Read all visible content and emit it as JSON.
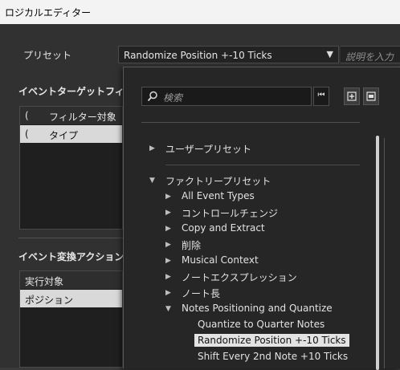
{
  "window": {
    "title": "ロジカルエディター"
  },
  "preset": {
    "label": "プリセット",
    "value": "Randomize Position +-10 Ticks",
    "description_placeholder": "説明を入力"
  },
  "target_filter": {
    "title": "イベントターゲットフィルタ",
    "headers": [
      "(",
      "フィルター対象"
    ],
    "rows": [
      {
        "paren": "(",
        "target": "タイプ"
      }
    ]
  },
  "actions": {
    "title": "イベント変換アクション",
    "headers": [
      "実行対象"
    ],
    "rows": [
      {
        "target": "ポジション"
      }
    ]
  },
  "popup": {
    "search_placeholder": "検索",
    "groups": [
      {
        "label": "ユーザープリセット",
        "expanded": false
      },
      {
        "label": "ファクトリープリセット",
        "expanded": true
      }
    ],
    "factory_items": [
      {
        "label": "All Event Types",
        "expanded": false
      },
      {
        "label": "コントロールチェンジ",
        "expanded": false
      },
      {
        "label": "Copy and Extract",
        "expanded": false
      },
      {
        "label": "削除",
        "expanded": false
      },
      {
        "label": "Musical Context",
        "expanded": false
      },
      {
        "label": "ノートエクスプレッション",
        "expanded": false
      },
      {
        "label": "ノート長",
        "expanded": false
      },
      {
        "label": "Notes Positioning and Quantize",
        "expanded": true
      }
    ],
    "sub_items": [
      {
        "label": "Quantize to Quarter Notes",
        "selected": false
      },
      {
        "label": "Randomize Position +-10 Ticks",
        "selected": true
      },
      {
        "label": "Shift Every 2nd Note +10 Ticks",
        "selected": false
      }
    ]
  },
  "colors": {
    "selection": "#e3e3e3",
    "background": "#313131"
  }
}
